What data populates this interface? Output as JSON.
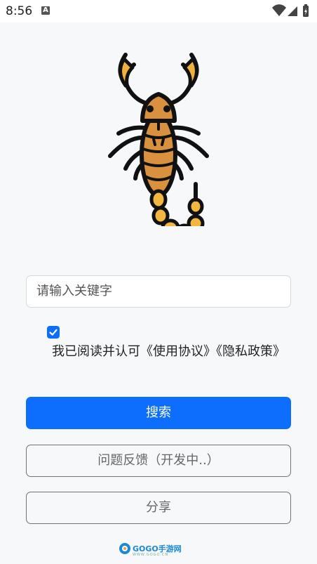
{
  "status": {
    "time": "8:56",
    "notification_icon_letter": "A",
    "icons": [
      "wifi-icon",
      "signal-icon",
      "battery-icon"
    ]
  },
  "main": {
    "search_placeholder": "请输入关键字",
    "agree_checked": true,
    "agree_text": "我已阅读并认可《使用协议》《隐私政策》",
    "search_button": "搜索",
    "feedback_button": "问题反馈（开发中..）",
    "share_button": "分享"
  },
  "footer": {
    "logo_text": "GOGO手游网",
    "logo_sub": "WWW.GOGO.CN"
  },
  "colors": {
    "primary": "#0d6efd",
    "scorpion_body": "#d9913f",
    "scorpion_tail": "#f3b63f",
    "outline": "#111111"
  }
}
